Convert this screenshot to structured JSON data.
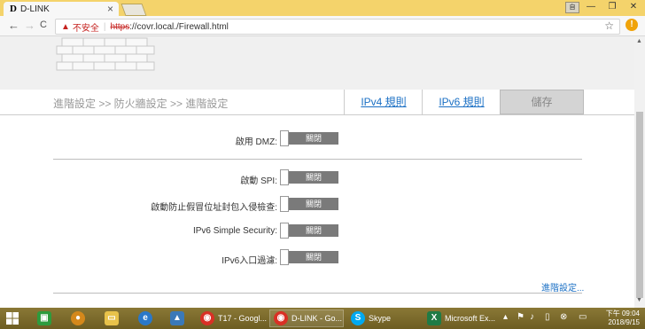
{
  "browser": {
    "tab_title": "D-LINK",
    "tab_logo": "D",
    "tab_close": "×",
    "user_badge": "自",
    "window_controls": [
      "—",
      "❐",
      "✕"
    ],
    "nav_back": "←",
    "nav_forward": "→",
    "nav_reload": "C",
    "security_label": "不安全",
    "url_scheme": "https",
    "url_rest": "://covr.local./Firewall.html",
    "star_icon": "☆",
    "menu_icon": "!"
  },
  "page": {
    "breadcrumb": "進階設定 >> 防火牆設定 >> 進階設定",
    "tabs": [
      {
        "label": "IPv4 規則"
      },
      {
        "label": "IPv6 規則"
      }
    ],
    "save_label": "儲存",
    "dmz": {
      "label": "啟用 DMZ:",
      "value": "關閉"
    },
    "settings": [
      {
        "label": "啟動 SPI:",
        "value": "關閉"
      },
      {
        "label": "啟動防止假冒位址封包入侵檢查:",
        "value": "關閉"
      },
      {
        "label": "IPv6 Simple Security:",
        "value": "關閉"
      },
      {
        "label": "IPv6入口過濾:",
        "value": "關閉"
      }
    ],
    "advanced_link": "進階設定..."
  },
  "taskbar": {
    "apps": [
      {
        "label": "T17 - Googl...",
        "icon": "chrome-icon"
      },
      {
        "label": "D-LINK - Go...",
        "icon": "chrome-icon"
      },
      {
        "label": "Skype",
        "icon": "skype-icon"
      },
      {
        "label": "Microsoft Ex...",
        "icon": "excel-icon"
      }
    ],
    "clock_time": "下午 09:04",
    "clock_date": "2018/9/15"
  },
  "colors": {
    "chrome_frame": "#f4d36b",
    "toggle_off": "#7a7a7a",
    "link": "#1a6fc4",
    "taskbar": "#7a6a2a"
  }
}
